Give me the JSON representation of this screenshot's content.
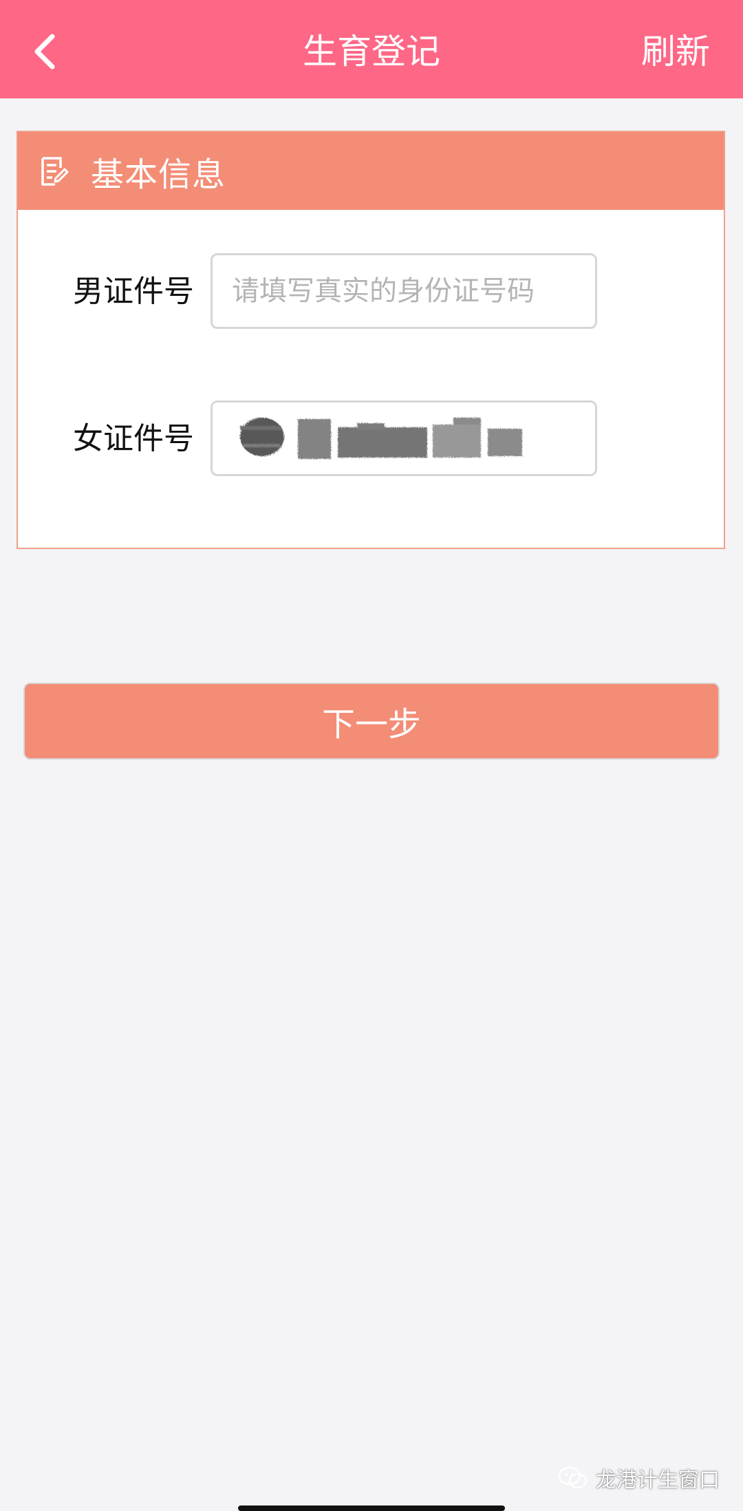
{
  "header": {
    "title": "生育登记",
    "back_icon": "chevron-left-icon",
    "refresh_label": "刷新",
    "background": "#ff6786"
  },
  "card": {
    "title": "基本信息",
    "icon": "edit-form-icon",
    "header_color": "#f38d76",
    "fields": [
      {
        "label": "男证件号",
        "placeholder": "请填写真实的身份证号码",
        "value": ""
      },
      {
        "label": "女证件号",
        "placeholder": "",
        "value": "",
        "redacted": true
      }
    ]
  },
  "actions": {
    "next_label": "下一步"
  },
  "watermark": {
    "text": "龙港计生窗口",
    "icon": "wechat-icon"
  }
}
